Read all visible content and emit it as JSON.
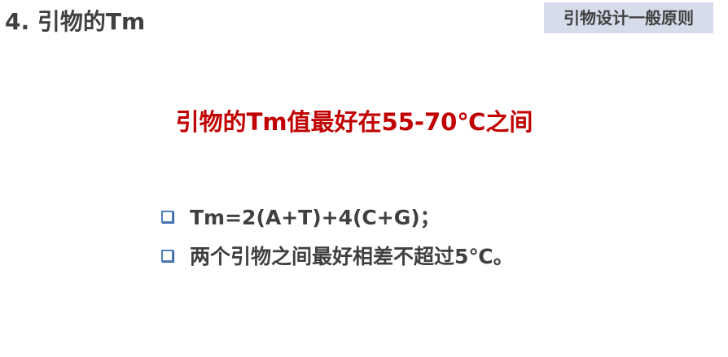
{
  "slide": {
    "title": "4. 引物的Tm",
    "section_tag": "引物设计一般原则",
    "headline": "引物的Tm值最好在55-70℃之间",
    "bullets": [
      "Tm=2(A+T)+4(C+G)；",
      "两个引物之间最好相差不超过5℃。"
    ]
  },
  "colors": {
    "title_text": "#404040",
    "tag_background": "#d6dcea",
    "headline_text": "#c00000",
    "bullet_box": "#4f81bd"
  }
}
